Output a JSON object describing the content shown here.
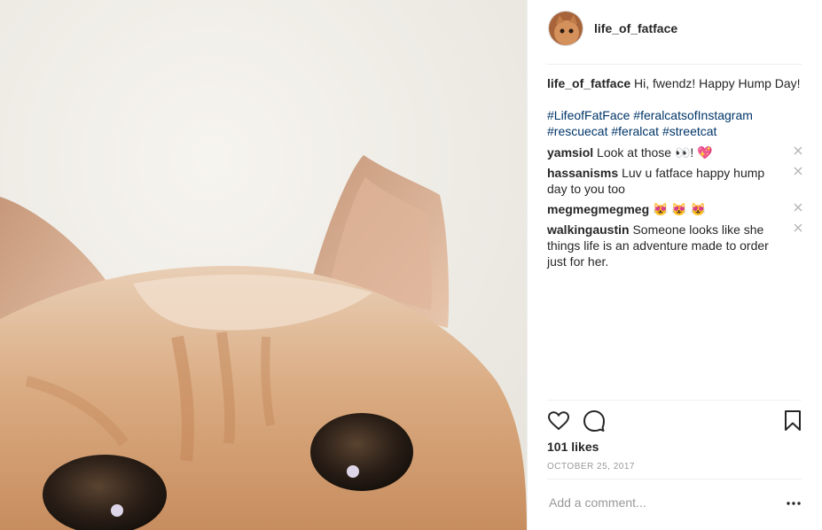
{
  "post": {
    "username": "life_of_fatface",
    "caption_user": "life_of_fatface",
    "caption_text": "Hi, fwendz! Happy Hump Day!",
    "hashtags": [
      "#LifeofFatFace",
      "#feralcatsofInstagram",
      "#rescuecat",
      "#feralcat",
      "#streetcat"
    ],
    "likes": "101 likes",
    "date": "OCTOBER 25, 2017",
    "add_comment_placeholder": "Add a comment..."
  },
  "comments": [
    {
      "user": "yamsiol",
      "text": "Look at those 👀! 💖"
    },
    {
      "user": "hassanisms",
      "text": "Luv u fatface happy hump day to you too"
    },
    {
      "user": "megmegmegmeg",
      "text": "😻 😻 😻"
    },
    {
      "user": "walkingaustin",
      "text": "Someone looks like she things life is an adventure made to order just for her."
    }
  ],
  "icons": {
    "like": "heart-icon",
    "comment": "speech-bubble-icon",
    "save": "bookmark-icon",
    "remove": "close-icon",
    "more": "more-options-icon"
  },
  "colors": {
    "hashtag": "#003569",
    "text": "#262626",
    "muted": "#999999"
  }
}
